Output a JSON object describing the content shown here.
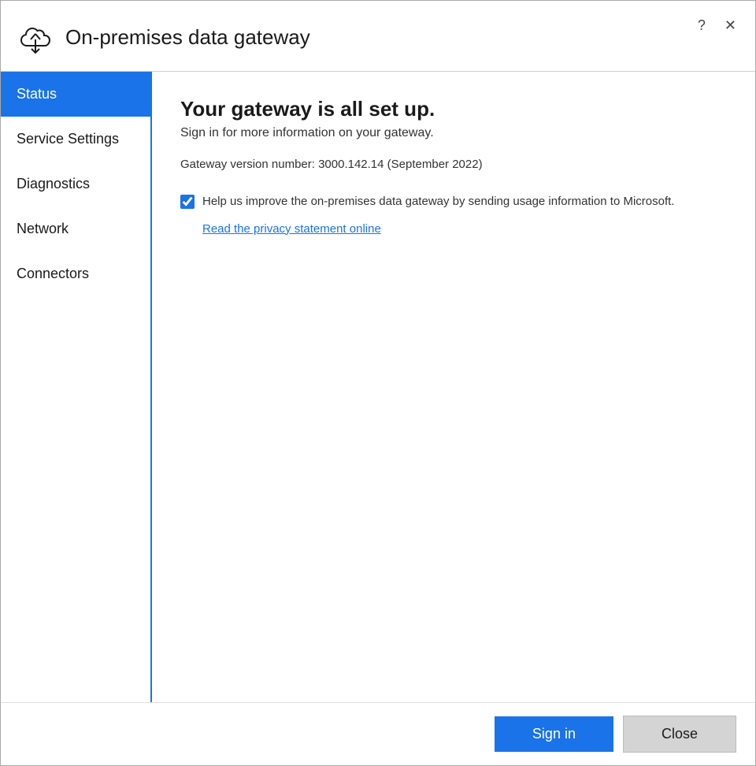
{
  "window": {
    "title": "On-premises data gateway"
  },
  "titlebar": {
    "help_label": "?",
    "close_label": "✕"
  },
  "sidebar": {
    "items": [
      {
        "id": "status",
        "label": "Status",
        "active": true
      },
      {
        "id": "service-settings",
        "label": "Service Settings",
        "active": false
      },
      {
        "id": "diagnostics",
        "label": "Diagnostics",
        "active": false
      },
      {
        "id": "network",
        "label": "Network",
        "active": false
      },
      {
        "id": "connectors",
        "label": "Connectors",
        "active": false
      }
    ]
  },
  "content": {
    "heading": "Your gateway is all set up.",
    "subtext": "Sign in for more information on your gateway.",
    "version": "Gateway version number: 3000.142.14 (September 2022)",
    "checkbox_label": "Help us improve the on-premises data gateway by sending usage information to Microsoft.",
    "privacy_link": "Read the privacy statement online"
  },
  "footer": {
    "signin_label": "Sign in",
    "close_label": "Close"
  }
}
